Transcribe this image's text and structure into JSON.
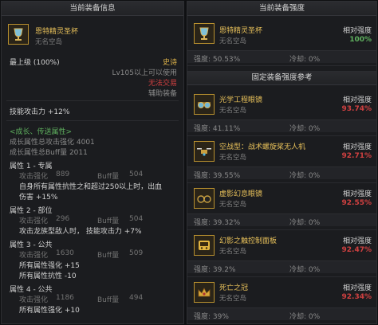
{
  "left": {
    "title": "当前装备信息",
    "item": {
      "name": "恩特精灵圣杯",
      "sub": "无名空岛",
      "icon": "chalice-icon"
    },
    "top_grade": "最上级 (100%)",
    "rarity": "史诗",
    "level_req": "Lv105以上可以使用",
    "trade": "无法交易",
    "slot": "辅助装备",
    "skill_atk": "技能攻击力 +12%",
    "growth_header": "<成长、传送属性>",
    "growth_atk": "成长属性总攻击强化 4001",
    "growth_buff": "成长属性总Buff量 2011",
    "attrs": [
      {
        "header": "属性 1 - 专属",
        "atk_label": "攻击强化",
        "atk_val": "889",
        "buff_label": "Buff量",
        "buff_val": "504",
        "effects": [
          "自身所有属性抗性之和超过250以上时，出血",
          "伤害 +15%"
        ]
      },
      {
        "header": "属性 2 - 部位",
        "atk_label": "攻击强化",
        "atk_val": "296",
        "buff_label": "Buff量",
        "buff_val": "504",
        "effects": [
          "攻击龙族型敌人时，    技能攻击力 +7%"
        ]
      },
      {
        "header": "属性 3 - 公共",
        "atk_label": "攻击强化",
        "atk_val": "1630",
        "buff_label": "Buff量",
        "buff_val": "509",
        "effects": [
          "所有属性强化 +15",
          "所有属性抗性 -10"
        ]
      },
      {
        "header": "属性 4 - 公共",
        "atk_label": "攻击强化",
        "atk_val": "1186",
        "buff_label": "Buff量",
        "buff_val": "494",
        "effects": [
          "所有属性强化 +10"
        ]
      }
    ]
  },
  "right": {
    "title": "当前装备强度",
    "current": {
      "name": "恩特精灵圣杯",
      "sub": "无名空岛",
      "icon": "chalice-icon",
      "rel_label": "相对强度",
      "rel_val": "100%",
      "strength": "强度: 50.53%",
      "cooldown": "冷却: 0%"
    },
    "ref_title": "固定装备强度参考",
    "refs": [
      {
        "name": "光学工程眼镜",
        "sub": "无名空岛",
        "icon": "goggles-icon",
        "rel_label": "相对强度",
        "rel_val": "93.74%",
        "strength": "强度: 41.11%",
        "cooldown": "冷却: 0%"
      },
      {
        "name": "空战型：战术螺旋桨无人机",
        "sub": "无名空岛",
        "icon": "drone-icon",
        "rel_label": "相对强度",
        "rel_val": "92.71%",
        "strength": "强度: 39.55%",
        "cooldown": "冷却: 0%"
      },
      {
        "name": "虚影幻息眼镜",
        "sub": "无名空岛",
        "icon": "glasses-icon",
        "rel_label": "相对强度",
        "rel_val": "92.55%",
        "strength": "强度: 39.32%",
        "cooldown": "冷却: 0%"
      },
      {
        "name": "幻影之触控制面板",
        "sub": "无名空岛",
        "icon": "control-panel-icon",
        "rel_label": "相对强度",
        "rel_val": "92.47%",
        "strength": "强度: 39.2%",
        "cooldown": "冷却: 0%"
      },
      {
        "name": "死亡之冠",
        "sub": "无名空岛",
        "icon": "crown-icon",
        "rel_label": "相对强度",
        "rel_val": "92.34%",
        "strength": "强度: 39%",
        "cooldown": "冷却: 0%"
      }
    ]
  },
  "colors": {
    "epic": "#e0b44a",
    "green": "#5fb15f",
    "red": "#d04040",
    "item_name": "#e8c15a"
  }
}
